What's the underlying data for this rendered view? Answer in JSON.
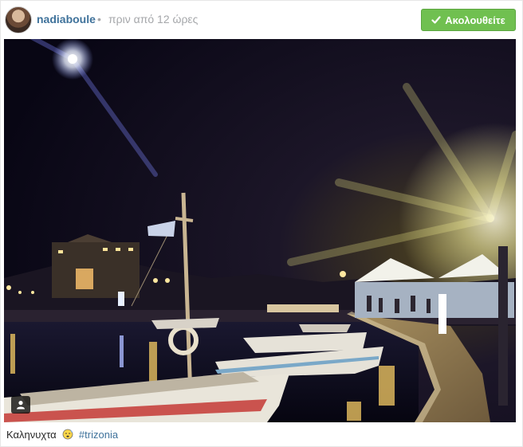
{
  "post": {
    "username": "nadiaboule",
    "separator": "•",
    "timestamp": "πριν από 12 ώρες",
    "follow_label": "Ακολουθείτε"
  },
  "caption": {
    "text": "Καληνυχτα",
    "hashtag": "#trizonia"
  },
  "colors": {
    "username": "#3f729b",
    "follow_button": "#70c050",
    "muted": "#a5a7aa"
  },
  "icons": {
    "follow": "check-icon",
    "tag": "person-icon",
    "caption_emoji": "sleepy-face-icon"
  }
}
